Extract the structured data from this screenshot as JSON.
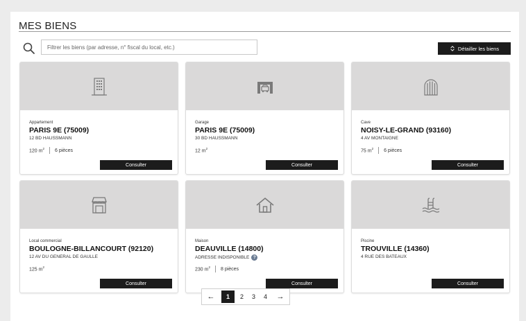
{
  "page": {
    "title": "MES BIENS",
    "search_placeholder": "Filtrer les biens (par adresse, n° fiscal du local, etc.)",
    "detail_button": "Détailler les biens"
  },
  "cards": [
    {
      "type": "Appartement",
      "city": "PARIS 9E (75009)",
      "address": "12 BD HAUSSMANN",
      "area": "120 m",
      "rooms": "6 pièces",
      "icon": "building-icon",
      "button": "Consulter"
    },
    {
      "type": "Garage",
      "city": "PARIS 9E (75009)",
      "address": "30 BD HAUSSMANN",
      "area": "12 m",
      "rooms": "",
      "icon": "garage-icon",
      "button": "Consulter"
    },
    {
      "type": "Cave",
      "city": "NOISY-LE-GRAND (93160)",
      "address": "4 AV MONTAIGNE",
      "area": "75 m",
      "rooms": "6 pièces",
      "icon": "cellar-door-icon",
      "button": "Consulter"
    },
    {
      "type": "Local commercial",
      "city": "BOULOGNE-BILLANCOURT (92120)",
      "address": "12 AV DU GENERAL DE GAULLE",
      "area": "125 m",
      "rooms": "",
      "icon": "shop-icon",
      "button": "Consulter"
    },
    {
      "type": "Maison",
      "city": "DEAUVILLE (14800)",
      "address": "ADRESSE INDISPONIBLE",
      "area": "230 m",
      "rooms": "8 pièces",
      "icon": "house-icon",
      "button": "Consulter",
      "help": "?"
    },
    {
      "type": "Piscine",
      "city": "TROUVILLE (14360)",
      "address": "4 RUE DES BATEAUX",
      "area": "",
      "rooms": "",
      "icon": "pool-icon",
      "button": "Consulter"
    }
  ],
  "area_unit_sup": "2",
  "pagination": {
    "prev": "←",
    "pages": [
      "1",
      "2",
      "3",
      "4"
    ],
    "active": "1",
    "next": "→"
  },
  "colors": {
    "background": "#ececec",
    "card_image_bg": "#dad9d9",
    "button_bg": "#1c1c1c",
    "icon_stroke": "#7a7a7a"
  }
}
